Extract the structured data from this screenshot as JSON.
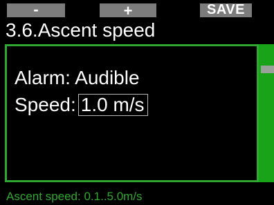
{
  "softkeys": {
    "minus_label": "-",
    "plus_label": "+",
    "save_label": "SAVE"
  },
  "screen": {
    "title": "3.6.Ascent speed"
  },
  "settings": {
    "alarm_label": "Alarm:",
    "alarm_value": "Audible",
    "speed_label": "Speed:",
    "speed_value": "1.0 m/s"
  },
  "hint": {
    "text": "Ascent speed: 0.1..5.0m/s"
  },
  "colors": {
    "accent_green": "#2fa82f",
    "scrollbar_green": "#19a319",
    "softkey_gray": "#7c7c7c",
    "background": "#000000",
    "text": "#ffffff"
  }
}
